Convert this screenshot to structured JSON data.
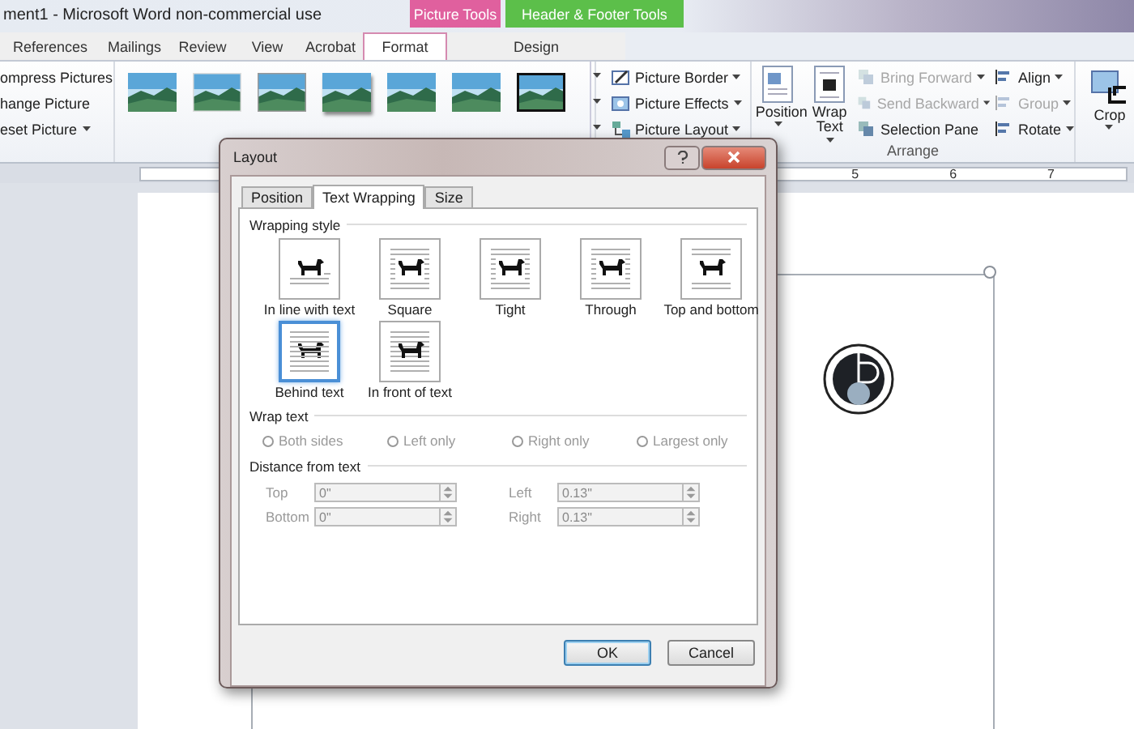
{
  "window": {
    "title": "ment1 - Microsoft Word non-commercial use"
  },
  "context_tabs": [
    {
      "label": "Picture Tools",
      "color": "#e0609e"
    },
    {
      "label": "Header & Footer Tools",
      "color": "#5cbf4a"
    }
  ],
  "tabs": [
    {
      "label": "References",
      "selected": false
    },
    {
      "label": "Mailings",
      "selected": false
    },
    {
      "label": "Review",
      "selected": false
    },
    {
      "label": "View",
      "selected": false
    },
    {
      "label": "Acrobat",
      "selected": false
    },
    {
      "label": "Format",
      "selected": true
    },
    {
      "label": "Design",
      "selected": false
    }
  ],
  "ribbon": {
    "adjust_items": [
      {
        "label": "ompress Pictures",
        "dropdown": false
      },
      {
        "label": "hange Picture",
        "dropdown": false
      },
      {
        "label": "eset Picture",
        "dropdown": true
      }
    ],
    "picture_styles": [
      {
        "kind": "soft"
      },
      {
        "kind": "white"
      },
      {
        "kind": "grey"
      },
      {
        "kind": "shadow"
      },
      {
        "kind": "soft"
      },
      {
        "kind": "soft"
      },
      {
        "kind": "black"
      }
    ],
    "picture_commands": [
      {
        "label": "Picture Border",
        "kind": "border"
      },
      {
        "label": "Picture Effects",
        "kind": "effects"
      },
      {
        "label": "Picture Layout",
        "kind": "layout"
      }
    ],
    "arrange_large": [
      {
        "label": "Position",
        "kind": "position"
      },
      {
        "label": "Wrap Text",
        "kind": "wrap"
      }
    ],
    "arrange_commands": [
      {
        "label": "Bring Forward",
        "disabled": true
      },
      {
        "label": "Send Backward",
        "disabled": true
      },
      {
        "label": "Selection Pane",
        "disabled": false
      }
    ],
    "align_commands": [
      {
        "label": "Align",
        "disabled": false
      },
      {
        "label": "Group",
        "disabled": true
      },
      {
        "label": "Rotate",
        "disabled": false
      }
    ],
    "arrange_label": "Arrange",
    "crop": {
      "label": "Crop"
    }
  },
  "ruler": {
    "numbers": [
      "5",
      "6",
      "7"
    ]
  },
  "dialog": {
    "title": "Layout",
    "tabs": [
      {
        "label": "Position",
        "selected": false
      },
      {
        "label": "Text Wrapping",
        "selected": true
      },
      {
        "label": "Size",
        "selected": false
      }
    ],
    "wrapping_style": {
      "heading": "Wrapping style",
      "options": [
        {
          "label": "In line with text",
          "kind": "inline",
          "selected": false
        },
        {
          "label": "Square",
          "kind": "square",
          "selected": false
        },
        {
          "label": "Tight",
          "kind": "tight",
          "selected": false
        },
        {
          "label": "Through",
          "kind": "through",
          "selected": false
        },
        {
          "label": "Top and bottom",
          "kind": "top_bottom",
          "selected": false
        },
        {
          "label": "Behind text",
          "kind": "behind",
          "selected": true
        },
        {
          "label": "In front of text",
          "kind": "front",
          "selected": false
        }
      ]
    },
    "wrap_text": {
      "heading": "Wrap text",
      "options": [
        {
          "label": "Both sides",
          "selected": false,
          "disabled": true
        },
        {
          "label": "Left only",
          "selected": false,
          "disabled": true
        },
        {
          "label": "Right only",
          "selected": false,
          "disabled": true
        },
        {
          "label": "Largest only",
          "selected": false,
          "disabled": true
        }
      ]
    },
    "distance": {
      "heading": "Distance from text",
      "fields": [
        {
          "label": "Top",
          "value": "0\"",
          "disabled": true
        },
        {
          "label": "Left",
          "value": "0.13\"",
          "disabled": true
        },
        {
          "label": "Bottom",
          "value": "0\"",
          "disabled": true
        },
        {
          "label": "Right",
          "value": "0.13\"",
          "disabled": true
        }
      ]
    },
    "buttons": [
      {
        "label": "OK",
        "default": true
      },
      {
        "label": "Cancel",
        "default": false
      }
    ]
  }
}
